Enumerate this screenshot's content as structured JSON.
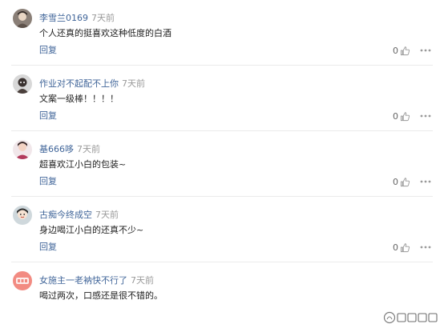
{
  "reply_label": "回复",
  "comments": [
    {
      "username": "李雪兰0169",
      "time": "7天前",
      "text": "个人还真的挺喜欢这种低度的白酒",
      "likes": "0",
      "avatar_icon": "user-photo-avatar-icon"
    },
    {
      "username": "作业对不起配不上你",
      "time": "7天前",
      "text": "文案一级棒！！！！",
      "likes": "0",
      "avatar_icon": "user-photo-avatar-icon"
    },
    {
      "username": "基666哆",
      "time": "7天前",
      "text": "超喜欢江小白的包装~",
      "likes": "0",
      "avatar_icon": "user-photo-avatar-icon"
    },
    {
      "username": "古痴今终成空",
      "time": "7天前",
      "text": "身边喝江小白的还真不少~",
      "likes": "0",
      "avatar_icon": "user-photo-avatar-icon"
    },
    {
      "username": "女施主一老衲快不行了",
      "time": "7天前",
      "text": "喝过两次，口感还是很不错的。",
      "likes": "",
      "avatar_icon": "user-photo-avatar-icon"
    }
  ],
  "colors": {
    "username": "#406599",
    "time": "#999999",
    "text": "#222222",
    "icon": "#999999"
  }
}
